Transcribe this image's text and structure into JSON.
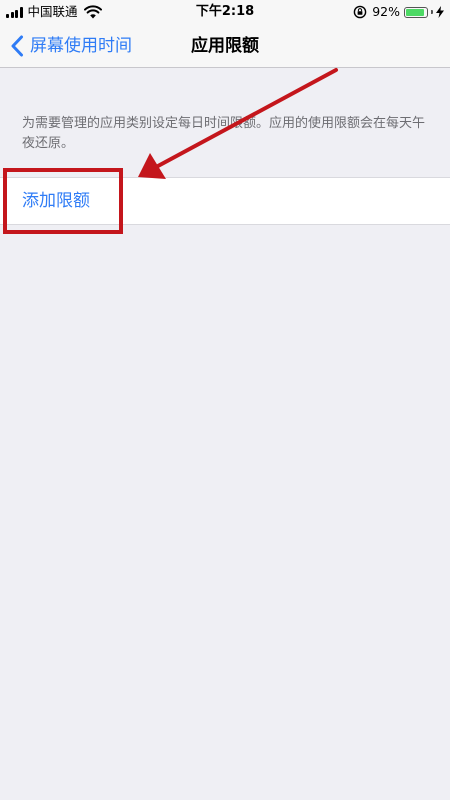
{
  "status_bar": {
    "carrier": "中国联通",
    "time": "下午2:18",
    "battery_percent": "92%",
    "battery_level": 0.92
  },
  "nav": {
    "back_label": "屏幕使用时间",
    "title": "应用限额"
  },
  "content": {
    "description": "为需要管理的应用类别设定每日时间限额。应用的使用限额会在每天午夜还原。",
    "add_limit_label": "添加限额"
  },
  "colors": {
    "accent": "#2f7cf6",
    "annotation": "#c4161c",
    "background": "#efeff4"
  },
  "icons": {
    "signal": "cellular-signal-icon",
    "wifi": "wifi-icon",
    "rotation_lock": "rotation-lock-icon",
    "battery": "battery-icon",
    "charging": "charging-bolt-icon",
    "back": "chevron-left-icon"
  }
}
